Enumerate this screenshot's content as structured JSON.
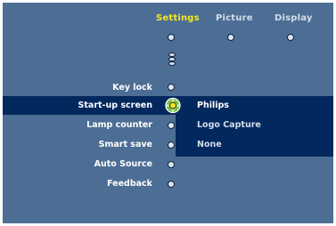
{
  "tabs": [
    {
      "label": "Settings",
      "active": true
    },
    {
      "label": "Picture",
      "active": false
    },
    {
      "label": "Display",
      "active": false
    }
  ],
  "menu_items": [
    {
      "label": "Key lock"
    },
    {
      "label": "Start-up screen",
      "selected": true
    },
    {
      "label": "Lamp counter"
    },
    {
      "label": "Smart save"
    },
    {
      "label": "Auto Source"
    },
    {
      "label": "Feedback"
    }
  ],
  "submenu": [
    {
      "label": "Philips",
      "selected": true
    },
    {
      "label": "Logo Capture"
    },
    {
      "label": "None"
    }
  ],
  "colors": {
    "background": "#4d6e94",
    "highlight": "#02285e",
    "active_tab": "#f6e61f",
    "selector": "#7fc142"
  }
}
